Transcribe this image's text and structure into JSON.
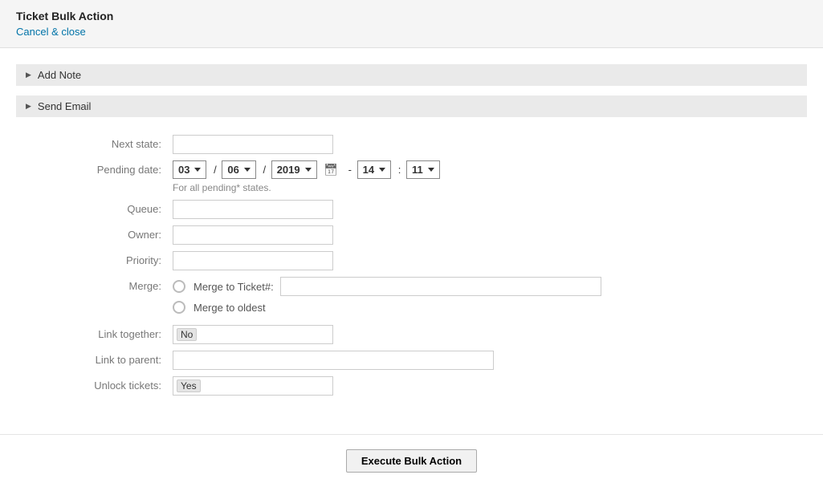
{
  "header": {
    "title": "Ticket Bulk Action",
    "cancel_link": "Cancel & close"
  },
  "accordions": {
    "add_note": "Add Note",
    "send_email": "Send Email"
  },
  "form": {
    "next_state": {
      "label": "Next state:",
      "value": ""
    },
    "pending_date": {
      "label": "Pending date:",
      "month": "03",
      "day": "06",
      "year": "2019",
      "hour": "14",
      "minute": "11",
      "helper": "For all pending* states."
    },
    "queue": {
      "label": "Queue:",
      "value": ""
    },
    "owner": {
      "label": "Owner:",
      "value": ""
    },
    "priority": {
      "label": "Priority:",
      "value": ""
    },
    "merge": {
      "label": "Merge:",
      "option_ticket": "Merge to Ticket#:",
      "option_oldest": "Merge to oldest",
      "value": ""
    },
    "link_together": {
      "label": "Link together:",
      "value": "No"
    },
    "link_to_parent": {
      "label": "Link to parent:",
      "value": ""
    },
    "unlock_tickets": {
      "label": "Unlock tickets:",
      "value": "Yes"
    }
  },
  "footer": {
    "execute": "Execute Bulk Action"
  }
}
